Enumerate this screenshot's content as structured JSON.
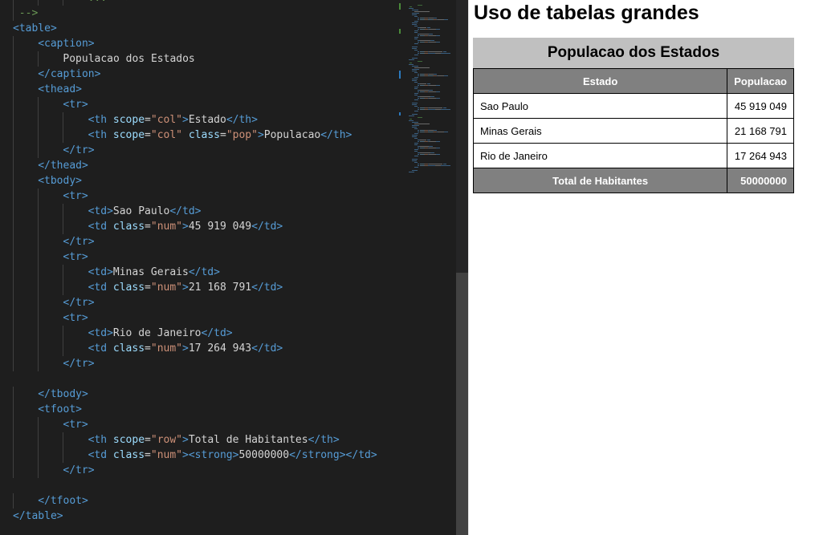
{
  "editor": {
    "lines": [
      {
        "indent": 12,
        "tokens": [
          {
            "text": "... -->",
            "c": "cmt"
          }
        ]
      },
      {
        "indent": 1,
        "tokens": [
          {
            "text": "-->",
            "c": "cmt"
          }
        ]
      },
      {
        "indent": 0,
        "tokens": [
          {
            "text": "<table>",
            "c": "tag"
          }
        ]
      },
      {
        "indent": 4,
        "tokens": [
          {
            "text": "<caption>",
            "c": "tag"
          }
        ]
      },
      {
        "indent": 8,
        "tokens": [
          {
            "text": "Populacao dos Estados",
            "c": "txt"
          }
        ]
      },
      {
        "indent": 4,
        "tokens": [
          {
            "text": "</caption>",
            "c": "tag"
          }
        ]
      },
      {
        "indent": 4,
        "tokens": [
          {
            "text": "<thead>",
            "c": "tag"
          }
        ]
      },
      {
        "indent": 8,
        "tokens": [
          {
            "text": "<tr>",
            "c": "tag"
          }
        ]
      },
      {
        "indent": 12,
        "tokens": [
          {
            "text": "<th",
            "c": "tag"
          },
          {
            "text": " scope",
            "c": "attr"
          },
          {
            "text": "=",
            "c": "txt"
          },
          {
            "text": "\"col\"",
            "c": "str"
          },
          {
            "text": ">",
            "c": "tag"
          },
          {
            "text": "Estado",
            "c": "txt"
          },
          {
            "text": "</th>",
            "c": "tag"
          }
        ]
      },
      {
        "indent": 12,
        "tokens": [
          {
            "text": "<th",
            "c": "tag"
          },
          {
            "text": " scope",
            "c": "attr"
          },
          {
            "text": "=",
            "c": "txt"
          },
          {
            "text": "\"col\"",
            "c": "str"
          },
          {
            "text": " class",
            "c": "attr"
          },
          {
            "text": "=",
            "c": "txt"
          },
          {
            "text": "\"pop\"",
            "c": "str"
          },
          {
            "text": ">",
            "c": "tag"
          },
          {
            "text": "Populacao",
            "c": "txt"
          },
          {
            "text": "</th>",
            "c": "tag"
          }
        ]
      },
      {
        "indent": 8,
        "tokens": [
          {
            "text": "</tr>",
            "c": "tag"
          }
        ]
      },
      {
        "indent": 4,
        "tokens": [
          {
            "text": "</thead>",
            "c": "tag"
          }
        ]
      },
      {
        "indent": 4,
        "tokens": [
          {
            "text": "<tbody>",
            "c": "tag"
          }
        ]
      },
      {
        "indent": 8,
        "tokens": [
          {
            "text": "<tr>",
            "c": "tag"
          }
        ]
      },
      {
        "indent": 12,
        "tokens": [
          {
            "text": "<td>",
            "c": "tag"
          },
          {
            "text": "Sao Paulo",
            "c": "txt"
          },
          {
            "text": "</td>",
            "c": "tag"
          }
        ]
      },
      {
        "indent": 12,
        "tokens": [
          {
            "text": "<td",
            "c": "tag"
          },
          {
            "text": " class",
            "c": "attr"
          },
          {
            "text": "=",
            "c": "txt"
          },
          {
            "text": "\"num\"",
            "c": "str"
          },
          {
            "text": ">",
            "c": "tag"
          },
          {
            "text": "45 919 049",
            "c": "txt"
          },
          {
            "text": "</td>",
            "c": "tag"
          }
        ]
      },
      {
        "indent": 8,
        "tokens": [
          {
            "text": "</tr>",
            "c": "tag"
          }
        ]
      },
      {
        "indent": 8,
        "tokens": [
          {
            "text": "<tr>",
            "c": "tag"
          }
        ]
      },
      {
        "indent": 12,
        "tokens": [
          {
            "text": "<td>",
            "c": "tag"
          },
          {
            "text": "Minas Gerais",
            "c": "txt"
          },
          {
            "text": "</td>",
            "c": "tag"
          }
        ]
      },
      {
        "indent": 12,
        "tokens": [
          {
            "text": "<td",
            "c": "tag"
          },
          {
            "text": " class",
            "c": "attr"
          },
          {
            "text": "=",
            "c": "txt"
          },
          {
            "text": "\"num\"",
            "c": "str"
          },
          {
            "text": ">",
            "c": "tag"
          },
          {
            "text": "21 168 791",
            "c": "txt"
          },
          {
            "text": "</td>",
            "c": "tag"
          }
        ]
      },
      {
        "indent": 8,
        "tokens": [
          {
            "text": "</tr>",
            "c": "tag"
          }
        ]
      },
      {
        "indent": 8,
        "tokens": [
          {
            "text": "<tr>",
            "c": "tag"
          }
        ]
      },
      {
        "indent": 12,
        "tokens": [
          {
            "text": "<td>",
            "c": "tag"
          },
          {
            "text": "Rio de Janeiro",
            "c": "txt"
          },
          {
            "text": "</td>",
            "c": "tag"
          }
        ]
      },
      {
        "indent": 12,
        "tokens": [
          {
            "text": "<td",
            "c": "tag"
          },
          {
            "text": " class",
            "c": "attr"
          },
          {
            "text": "=",
            "c": "txt"
          },
          {
            "text": "\"num\"",
            "c": "str"
          },
          {
            "text": ">",
            "c": "tag"
          },
          {
            "text": "17 264 943",
            "c": "txt"
          },
          {
            "text": "</td>",
            "c": "tag"
          }
        ]
      },
      {
        "indent": 8,
        "tokens": [
          {
            "text": "</tr>",
            "c": "tag"
          }
        ]
      },
      {
        "indent": 0,
        "tokens": []
      },
      {
        "indent": 4,
        "tokens": [
          {
            "text": "</tbody>",
            "c": "tag"
          }
        ]
      },
      {
        "indent": 4,
        "tokens": [
          {
            "text": "<tfoot>",
            "c": "tag"
          }
        ]
      },
      {
        "indent": 8,
        "tokens": [
          {
            "text": "<tr>",
            "c": "tag"
          }
        ]
      },
      {
        "indent": 12,
        "tokens": [
          {
            "text": "<th",
            "c": "tag"
          },
          {
            "text": " scope",
            "c": "attr"
          },
          {
            "text": "=",
            "c": "txt"
          },
          {
            "text": "\"row\"",
            "c": "str"
          },
          {
            "text": ">",
            "c": "tag"
          },
          {
            "text": "Total de Habitantes",
            "c": "txt"
          },
          {
            "text": "</th>",
            "c": "tag"
          }
        ]
      },
      {
        "indent": 12,
        "tokens": [
          {
            "text": "<td",
            "c": "tag"
          },
          {
            "text": " class",
            "c": "attr"
          },
          {
            "text": "=",
            "c": "txt"
          },
          {
            "text": "\"num\"",
            "c": "str"
          },
          {
            "text": ">",
            "c": "tag"
          },
          {
            "text": "<strong>",
            "c": "tag"
          },
          {
            "text": "50000000",
            "c": "txt"
          },
          {
            "text": "</strong>",
            "c": "tag"
          },
          {
            "text": "</td>",
            "c": "tag"
          }
        ]
      },
      {
        "indent": 8,
        "tokens": [
          {
            "text": "</tr>",
            "c": "tag"
          }
        ]
      },
      {
        "indent": 0,
        "tokens": []
      },
      {
        "indent": 4,
        "tokens": [
          {
            "text": "</tfoot>",
            "c": "tag"
          }
        ]
      },
      {
        "indent": 0,
        "tokens": [
          {
            "text": "</table>",
            "c": "tag"
          }
        ]
      }
    ],
    "colors": {
      "background": "#1e1e1e",
      "tag": "#569cd6",
      "attribute": "#9cdcfe",
      "string": "#ce9178",
      "comment": "#6a9955",
      "text": "#d4d4d4"
    }
  },
  "preview": {
    "heading": "Uso de tabelas grandes",
    "table": {
      "caption": "Populacao dos Estados",
      "headers": [
        "Estado",
        "Populacao"
      ],
      "rows": [
        {
          "estado": "Sao Paulo",
          "populacao": "45 919 049"
        },
        {
          "estado": "Minas Gerais",
          "populacao": "21 168 791"
        },
        {
          "estado": "Rio de Janeiro",
          "populacao": "17 264 943"
        }
      ],
      "footer": {
        "label": "Total de Habitantes",
        "value": "50000000"
      }
    },
    "colors": {
      "caption_background": "#c0c0c0",
      "header_background": "#808080",
      "header_text": "#ffffff"
    }
  }
}
